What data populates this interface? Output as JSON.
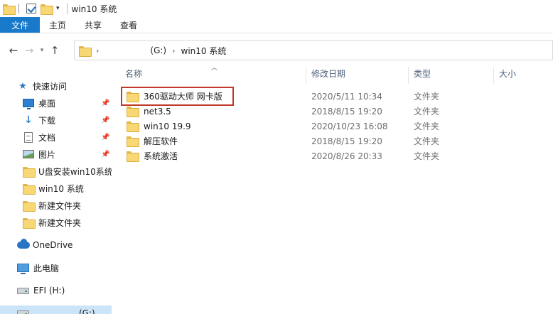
{
  "window": {
    "title": "win10 系统"
  },
  "ribbon": {
    "file_label": "文件",
    "tabs": [
      "主页",
      "共享",
      "查看"
    ]
  },
  "nav": {
    "back_icon": "arrow-left-icon",
    "forward_icon": "arrow-right-icon",
    "up_icon": "arrow-up-icon",
    "breadcrumb": {
      "drive": "(G:)",
      "folder": "win10 系统"
    }
  },
  "sidebar": {
    "items": [
      {
        "label": "快速访问",
        "icon": "star-icon"
      },
      {
        "label": "桌面",
        "icon": "desktop-icon",
        "pinned": true
      },
      {
        "label": "下载",
        "icon": "download-icon",
        "pinned": true
      },
      {
        "label": "文档",
        "icon": "document-icon",
        "pinned": true
      },
      {
        "label": "图片",
        "icon": "pictures-icon",
        "pinned": true
      },
      {
        "label": "U盘安装win10系统",
        "icon": "folder-icon"
      },
      {
        "label": "win10 系统",
        "icon": "folder-icon"
      },
      {
        "label": "新建文件夹",
        "icon": "folder-icon"
      },
      {
        "label": "新建文件夹",
        "icon": "folder-icon"
      },
      {
        "label": "OneDrive",
        "icon": "cloud-icon"
      },
      {
        "label": "此电脑",
        "icon": "computer-icon"
      },
      {
        "label": "EFI (H:)",
        "icon": "drive-icon"
      },
      {
        "label": "(G:)",
        "icon": "drive-icon"
      }
    ]
  },
  "columns": {
    "name": "名称",
    "date": "修改日期",
    "type": "类型",
    "size": "大小"
  },
  "files": [
    {
      "name": "360驱动大师 网卡版",
      "date": "2020/5/11 10:34",
      "type": "文件夹"
    },
    {
      "name": "net3.5",
      "date": "2018/8/15 19:20",
      "type": "文件夹"
    },
    {
      "name": "win10 19.9",
      "date": "2020/10/23 16:08",
      "type": "文件夹"
    },
    {
      "name": "解压软件",
      "date": "2018/8/15 19:20",
      "type": "文件夹"
    },
    {
      "name": "系统激活",
      "date": "2020/8/26 20:33",
      "type": "文件夹"
    }
  ],
  "colors": {
    "file_tab": "#1979ca",
    "highlight_box": "#c0392b",
    "folder": "#f8d775"
  }
}
